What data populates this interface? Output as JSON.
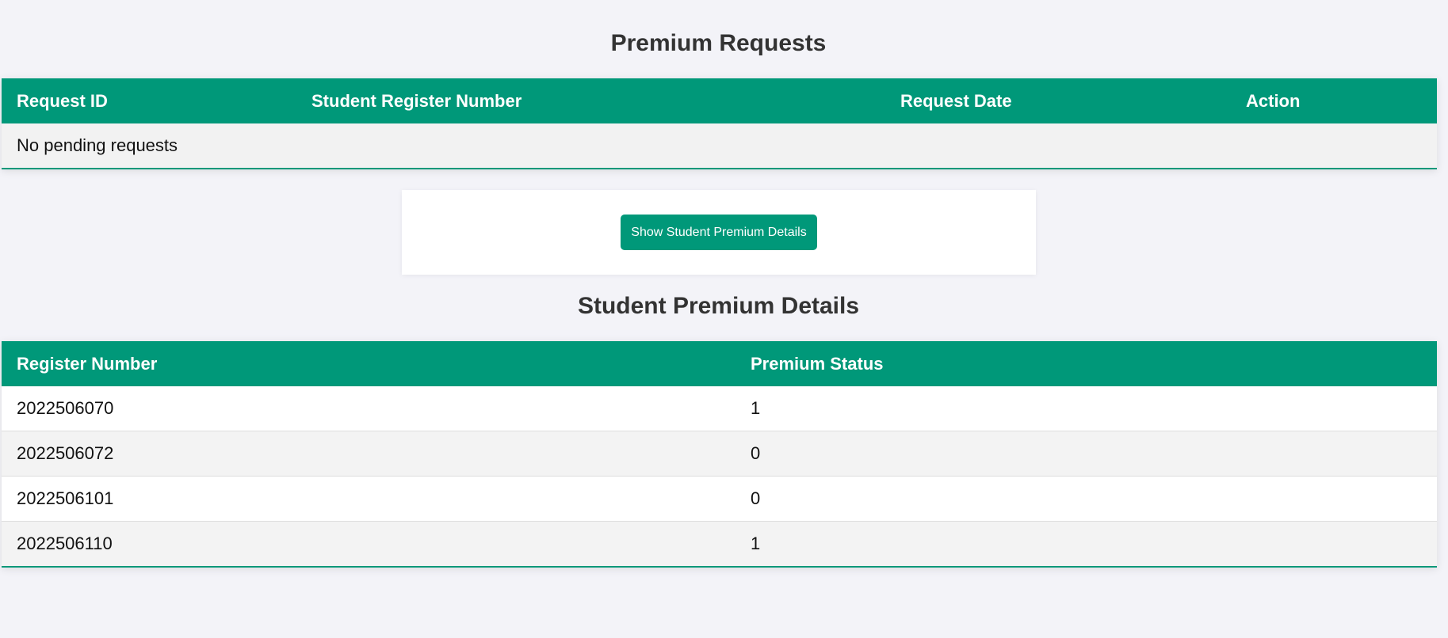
{
  "requests": {
    "title": "Premium Requests",
    "columns": [
      "Request ID",
      "Student Register Number",
      "Request Date",
      "Action"
    ],
    "empty_text": "No pending requests"
  },
  "toggle_button": {
    "label": "Show Student Premium Details"
  },
  "details": {
    "title": "Student Premium Details",
    "columns": [
      "Register Number",
      "Premium Status"
    ],
    "rows": [
      {
        "register_number": "2022506070",
        "premium_status": "1"
      },
      {
        "register_number": "2022506072",
        "premium_status": "0"
      },
      {
        "register_number": "2022506101",
        "premium_status": "0"
      },
      {
        "register_number": "2022506110",
        "premium_status": "1"
      }
    ]
  },
  "colors": {
    "accent": "#009879",
    "background": "#f3f3f8"
  }
}
